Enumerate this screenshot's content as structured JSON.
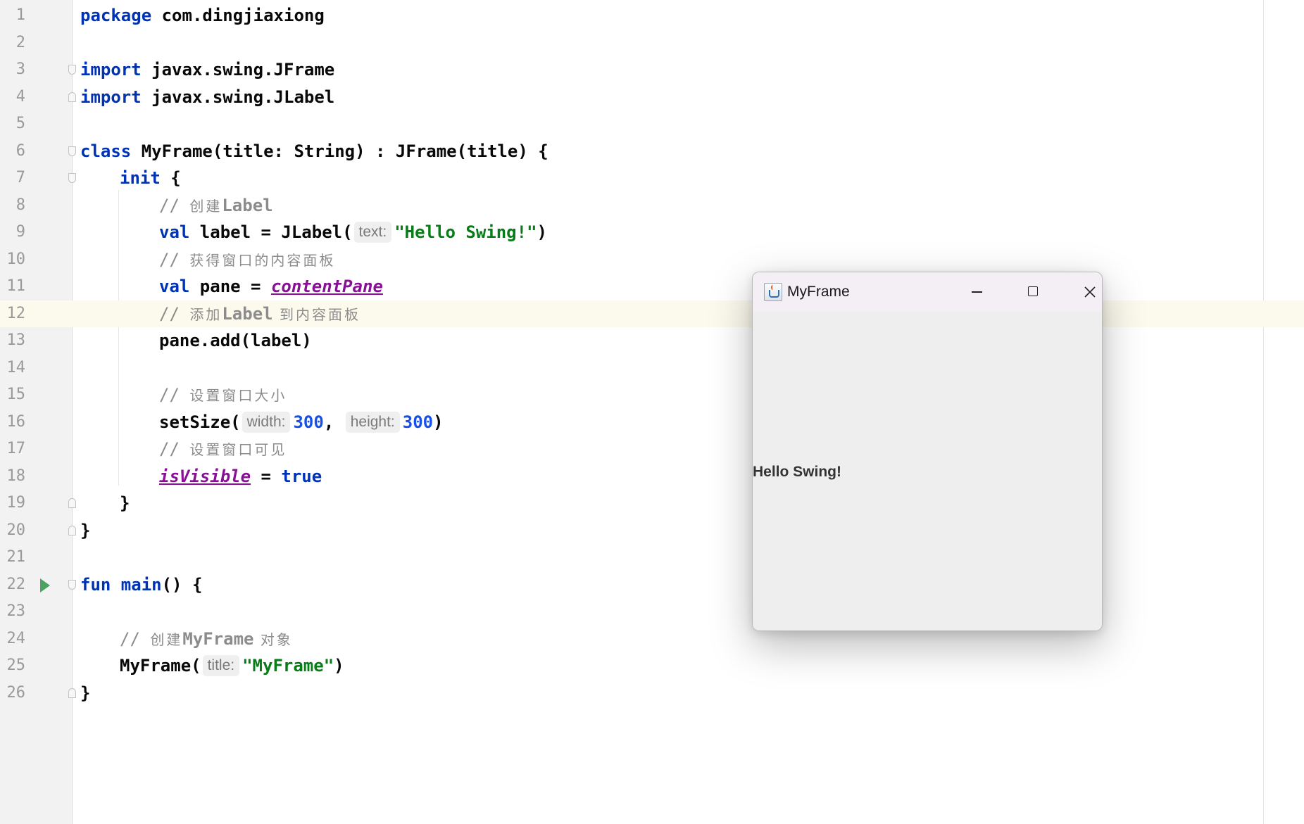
{
  "editor": {
    "lines": [
      {
        "n": "1",
        "tokens": [
          {
            "t": "package",
            "c": "kw"
          },
          {
            "t": " com.dingjiaxiong",
            "c": ""
          }
        ]
      },
      {
        "n": "2",
        "tokens": []
      },
      {
        "n": "3",
        "tokens": [
          {
            "t": "import",
            "c": "kw"
          },
          {
            "t": " javax.swing.JFrame",
            "c": ""
          }
        ]
      },
      {
        "n": "4",
        "tokens": [
          {
            "t": "import",
            "c": "kw"
          },
          {
            "t": " javax.swing.JLabel",
            "c": ""
          }
        ]
      },
      {
        "n": "5",
        "tokens": []
      },
      {
        "n": "6",
        "tokens": [
          {
            "t": "class",
            "c": "kw"
          },
          {
            "t": " MyFrame(title: String) : JFrame(title) {",
            "c": ""
          }
        ]
      },
      {
        "n": "7",
        "tokens": [
          {
            "t": "init",
            "c": "kw"
          },
          {
            "t": " {",
            "c": ""
          }
        ]
      },
      {
        "n": "8",
        "comment": {
          "en": "Label",
          "cn_before": "创建",
          "cn_after": ""
        }
      },
      {
        "n": "9",
        "tokens": [
          {
            "t": "val",
            "c": "kw"
          },
          {
            "t": " label = JLabel(",
            "c": ""
          },
          {
            "hint": "text:"
          },
          {
            "t": "\"Hello Swing!\"",
            "c": "str"
          },
          {
            "t": ")",
            "c": ""
          }
        ]
      },
      {
        "n": "10",
        "comment": {
          "en": "",
          "cn_before": "获得窗口的内容面板",
          "cn_after": ""
        }
      },
      {
        "n": "11",
        "tokens": [
          {
            "t": "val",
            "c": "kw"
          },
          {
            "t": " pane = ",
            "c": ""
          },
          {
            "t": "contentPane",
            "c": "prop"
          }
        ]
      },
      {
        "n": "12",
        "comment": {
          "en": "Label",
          "cn_before": "添加",
          "cn_after": " 到内容面板"
        }
      },
      {
        "n": "13",
        "tokens": [
          {
            "t": "pane.add(label)",
            "c": ""
          }
        ]
      },
      {
        "n": "14",
        "tokens": []
      },
      {
        "n": "15",
        "comment": {
          "en": "",
          "cn_before": "设置窗口大小",
          "cn_after": ""
        }
      },
      {
        "n": "16",
        "tokens": [
          {
            "t": "setSize(",
            "c": ""
          },
          {
            "hint": "width:"
          },
          {
            "t": "300",
            "c": "num"
          },
          {
            "t": ", ",
            "c": ""
          },
          {
            "hint": "height:"
          },
          {
            "t": "300",
            "c": "num"
          },
          {
            "t": ")",
            "c": ""
          }
        ]
      },
      {
        "n": "17",
        "comment": {
          "en": "",
          "cn_before": "设置窗口可见",
          "cn_after": ""
        }
      },
      {
        "n": "18",
        "tokens": [
          {
            "t": "isVisible",
            "c": "prop"
          },
          {
            "t": " = ",
            "c": ""
          },
          {
            "t": "true",
            "c": "kw"
          }
        ]
      },
      {
        "n": "19",
        "tokens": [
          {
            "t": "}",
            "c": ""
          }
        ]
      },
      {
        "n": "20",
        "tokens": [
          {
            "t": "}",
            "c": ""
          }
        ]
      },
      {
        "n": "21",
        "tokens": []
      },
      {
        "n": "22",
        "tokens": [
          {
            "t": "fun",
            "c": "kw"
          },
          {
            "t": " main",
            "c": "kw"
          },
          {
            "t": "() {",
            "c": ""
          }
        ]
      },
      {
        "n": "23",
        "tokens": []
      },
      {
        "n": "24",
        "comment": {
          "en": "MyFrame",
          "cn_before": "创建",
          "cn_after": " 对象"
        }
      },
      {
        "n": "25",
        "tokens": [
          {
            "t": "MyFrame(",
            "c": ""
          },
          {
            "hint": "title:"
          },
          {
            "t": "\"MyFrame\"",
            "c": "str"
          },
          {
            "t": ")",
            "c": ""
          }
        ]
      },
      {
        "n": "26",
        "tokens": [
          {
            "t": "}",
            "c": ""
          }
        ]
      }
    ],
    "comment_prefix": "// "
  },
  "swing_window": {
    "title": "MyFrame",
    "label_text": "Hello Swing!",
    "app_icon": "java-cup-icon",
    "controls": [
      "minimize-icon",
      "maximize-icon",
      "close-icon"
    ]
  }
}
